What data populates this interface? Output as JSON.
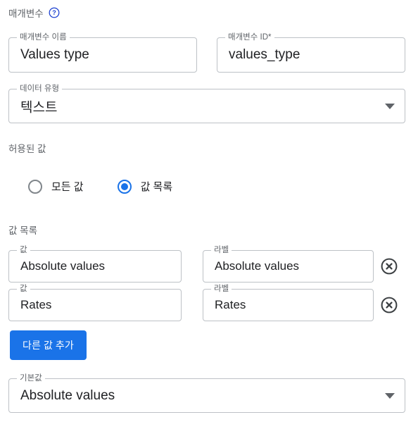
{
  "section": {
    "title": "매개변수",
    "help_icon": "help-circle-icon"
  },
  "fields": {
    "param_name": {
      "legend": "매개변수 이름",
      "value": "Values type"
    },
    "param_id": {
      "legend": "매개변수 ID*",
      "value": "values_type"
    },
    "data_type": {
      "legend": "데이터 유형",
      "value": "텍스트",
      "arrow_icon": "chevron-down-icon"
    },
    "default_value": {
      "legend": "기본값",
      "value": "Absolute values",
      "arrow_icon": "chevron-down-icon"
    }
  },
  "allowed_values": {
    "label": "허용된 값",
    "options": [
      {
        "label": "모든 값",
        "selected": false
      },
      {
        "label": "값 목록",
        "selected": true
      }
    ]
  },
  "value_list": {
    "label": "값 목록",
    "value_legend": "값",
    "label_legend": "라벨",
    "remove_icon": "remove-circle-x-icon",
    "rows": [
      {
        "value": "Absolute values",
        "label": "Absolute values"
      },
      {
        "value": "Rates",
        "label": "Rates"
      }
    ],
    "add_button": "다른 값 추가"
  },
  "colors": {
    "accent": "#1a73e8",
    "border": "#bdc1c6",
    "label_text": "#5f6368",
    "value_text": "#202124",
    "background": "#ffffff"
  }
}
